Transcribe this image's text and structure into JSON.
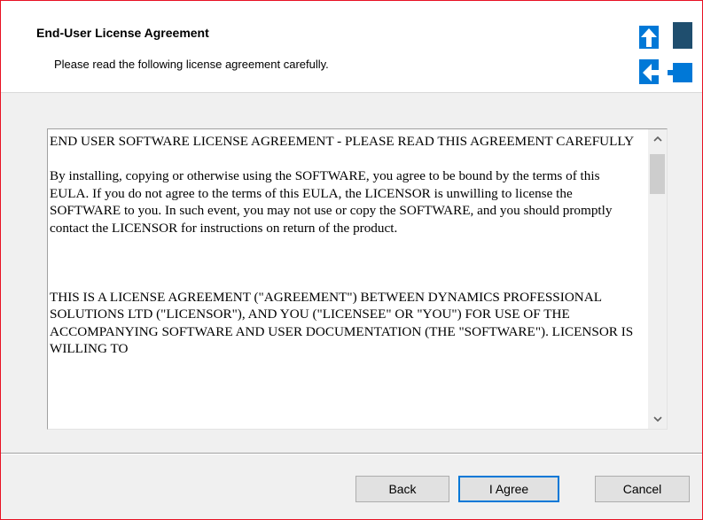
{
  "header": {
    "title": "End-User License Agreement",
    "subtitle": "Please read the following license agreement carefully."
  },
  "logo_icon": "installer-arrows-logo",
  "license": {
    "paragraphs": [
      "END USER SOFTWARE LICENSE AGREEMENT - PLEASE READ THIS AGREEMENT CAREFULLY",
      "By installing, copying or otherwise using the SOFTWARE, you agree to be bound by the terms of this EULA. If you do not agree to the terms of this EULA, the LICENSOR is unwilling to license the SOFTWARE to you.  In such event, you may not use or copy the SOFTWARE, and you should promptly contact the LICENSOR for instructions on return of the product.",
      "THIS IS A LICENSE AGREEMENT (\"AGREEMENT\") BETWEEN DYNAMICS PROFESSIONAL SOLUTIONS LTD (\"LICENSOR\"), AND YOU (\"LICENSEE\" OR \"YOU\") FOR USE OF THE ACCOMPANYING SOFTWARE AND USER DOCUMENTATION (THE \"SOFTWARE\").  LICENSOR IS WILLING TO"
    ],
    "scroll_up_icon": "chevron-up-icon",
    "scroll_down_icon": "chevron-down-icon"
  },
  "buttons": {
    "back": "Back",
    "agree": "I Agree",
    "cancel": "Cancel"
  },
  "colors": {
    "window_border": "#e81123",
    "logo_blue": "#0078d7",
    "logo_dark": "#1f4e6e",
    "focus_border": "#0078d7"
  }
}
